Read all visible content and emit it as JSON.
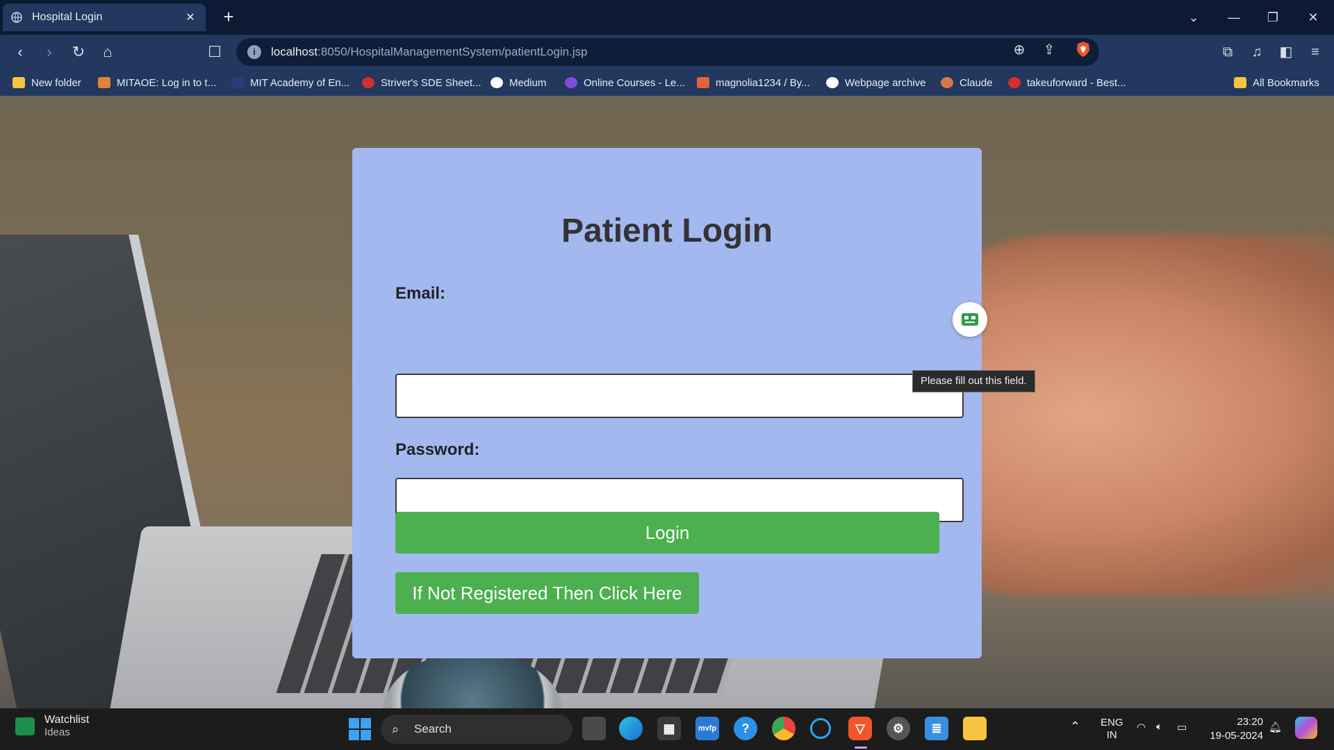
{
  "browser": {
    "tab_title": "Hospital Login",
    "tab_close": "✕",
    "new_tab": "+",
    "url_host": "localhost",
    "url_rest": ":8050/HospitalManagementSystem/patientLogin.jsp"
  },
  "bookmarks": [
    {
      "label": "New folder",
      "color": "#f6c342"
    },
    {
      "label": "MITAOE: Log in to t...",
      "color": "#e0843a"
    },
    {
      "label": "MIT Academy of En...",
      "color": "#2a3c78"
    },
    {
      "label": "Striver's SDE Sheet...",
      "color": "#d32f2f"
    },
    {
      "label": "Medium",
      "color": "#ffffff"
    },
    {
      "label": "Online Courses - Le...",
      "color": "#7c4ddc"
    },
    {
      "label": "magnolia1234 / By...",
      "color": "#e2643a"
    },
    {
      "label": "Webpage archive",
      "color": "#ffffff"
    },
    {
      "label": "Claude",
      "color": "#d9774b"
    },
    {
      "label": "takeuforward - Best...",
      "color": "#d32f2f"
    },
    {
      "label": "All Bookmarks",
      "color": "#f6c342"
    }
  ],
  "form": {
    "title": "Patient Login",
    "email_label": "Email:",
    "email_value": "",
    "password_label": "Password:",
    "password_value": "",
    "login_label": "Login",
    "register_label": "If Not Registered Then Click Here",
    "accent_color": "#4caf50",
    "card_color": "#a3b8ef"
  },
  "tooltip": "Please fill out this field.",
  "taskbar": {
    "widget_title": "Watchlist",
    "widget_sub": "Ideas",
    "search_label": "Search",
    "lang_top": "ENG",
    "lang_bottom": "IN",
    "time": "23:20",
    "date": "19-05-2024",
    "apps": [
      "file-explorer-window",
      "edge",
      "microsoft-store",
      "mvfp",
      "help",
      "chrome",
      "cortana",
      "brave",
      "settings",
      "notepad",
      "file-explorer"
    ]
  }
}
